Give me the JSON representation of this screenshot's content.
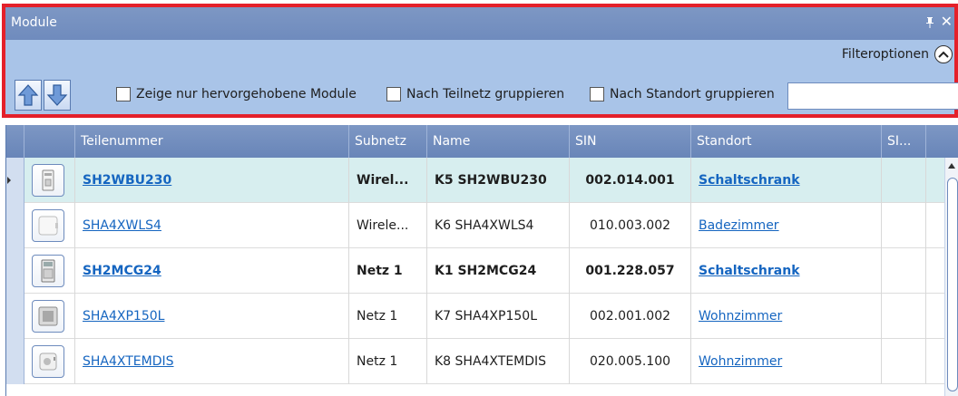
{
  "panel": {
    "title": "Module",
    "pin_glyph": "↕",
    "close_glyph": "✕",
    "filter_options_label": "Filteroptionen",
    "highlighted_only_label": "Zeige nur hervorgehobene Module",
    "group_subnet_label": "Nach Teilnetz gruppieren",
    "group_location_label": "Nach Standort gruppieren",
    "filter_value": "",
    "accent_color": "#e4202a"
  },
  "table": {
    "columns": [
      "Teilenummer",
      "Subnetz",
      "Name",
      "SIN",
      "Standort",
      "SI..."
    ],
    "rows": [
      {
        "part": "SH2WBU230",
        "subnet": "Wirel...",
        "name": "K5 SH2WBU230",
        "sin": "002.014.001",
        "location": "Schaltschrank",
        "icon": "power-module-icon"
      },
      {
        "part": "SHA4XWLS4",
        "subnet": "Wirele...",
        "name": "K6 SHA4XWLS4",
        "sin": "010.003.002",
        "location": "Badezimmer",
        "icon": "wall-switch-icon"
      },
      {
        "part": "SH2MCG24",
        "subnet": "Netz 1",
        "name": "K1 SH2MCG24",
        "sin": "001.228.057",
        "location": "Schaltschrank",
        "icon": "gateway-module-icon"
      },
      {
        "part": "SHA4XP150L",
        "subnet": "Netz 1",
        "name": "K7 SHA4XP150L",
        "sin": "002.001.002",
        "location": "Wohnzimmer",
        "icon": "dimmer-icon"
      },
      {
        "part": "SHA4XTEMDIS",
        "subnet": "Netz 1",
        "name": "K8 SHA4XTEMDIS",
        "sin": "020.005.100",
        "location": "Wohnzimmer",
        "icon": "thermostat-display-icon"
      }
    ]
  }
}
